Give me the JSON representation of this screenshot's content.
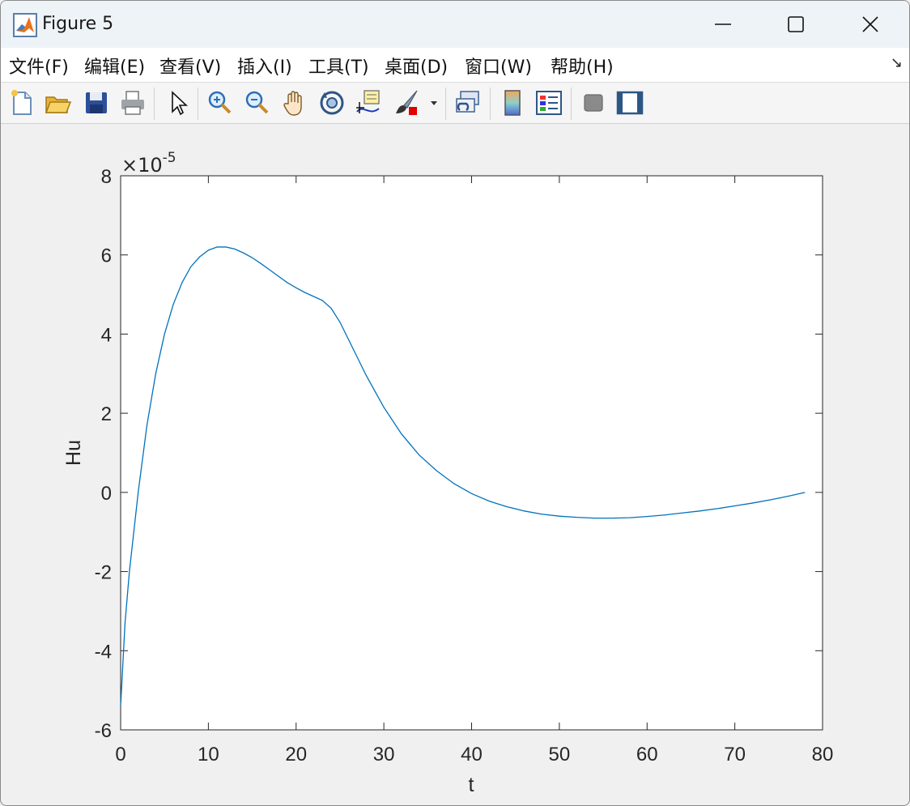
{
  "window": {
    "title": "Figure 5",
    "minimize_label": "—",
    "maximize_label": "☐",
    "close_label": "✕"
  },
  "menu": {
    "items": [
      {
        "label": "文件(F)",
        "name": "menu-file"
      },
      {
        "label": "编辑(E)",
        "name": "menu-edit"
      },
      {
        "label": "查看(V)",
        "name": "menu-view"
      },
      {
        "label": "插入(I)",
        "name": "menu-insert"
      },
      {
        "label": "工具(T)",
        "name": "menu-tools"
      },
      {
        "label": "桌面(D)",
        "name": "menu-desktop"
      },
      {
        "label": "窗口(W)",
        "name": "menu-window"
      },
      {
        "label": "帮助(H)",
        "name": "menu-help"
      }
    ],
    "dock_arrow": "↘"
  },
  "toolbar": {
    "icons": [
      "new-figure-icon",
      "open-folder-icon",
      "save-icon",
      "print-icon",
      "pointer-icon",
      "zoom-in-icon",
      "zoom-out-icon",
      "pan-hand-icon",
      "rotate-3d-icon",
      "data-cursor-icon",
      "brush-icon",
      "brush-dropdown-icon",
      "link-plot-icon",
      "colorbar-icon",
      "legend-icon",
      "hide-plot-tools-icon",
      "show-plot-tools-icon"
    ]
  },
  "chart_data": {
    "type": "line",
    "title": "",
    "xlabel": "t",
    "ylabel": "Hu",
    "exponent_label": "×10",
    "exponent_power": "-5",
    "xlim": [
      0,
      80
    ],
    "ylim": [
      -6,
      8
    ],
    "xticks": [
      0,
      10,
      20,
      30,
      40,
      50,
      60,
      70,
      80
    ],
    "yticks": [
      -6,
      -4,
      -2,
      0,
      2,
      4,
      6,
      8
    ],
    "line_color": "#0072bd",
    "grid": false,
    "series": [
      {
        "x": [
          0,
          0.5,
          1,
          2,
          3,
          4,
          5,
          6,
          7,
          8,
          9,
          10,
          11,
          12,
          13,
          14,
          15,
          16,
          17,
          18,
          19,
          20,
          21,
          22,
          23,
          24,
          25,
          26,
          27,
          28,
          29,
          30,
          32,
          34,
          36,
          38,
          40,
          42,
          44,
          46,
          48,
          50,
          52,
          54,
          56,
          58,
          60,
          62,
          64,
          66,
          68,
          70,
          72,
          74,
          76,
          78
        ],
        "y": [
          -5.4,
          -3.3,
          -2.0,
          0.0,
          1.7,
          3.0,
          4.0,
          4.75,
          5.3,
          5.7,
          5.95,
          6.12,
          6.2,
          6.2,
          6.15,
          6.05,
          5.93,
          5.78,
          5.62,
          5.46,
          5.3,
          5.17,
          5.05,
          4.95,
          4.85,
          4.65,
          4.3,
          3.85,
          3.4,
          2.95,
          2.55,
          2.15,
          1.48,
          0.95,
          0.55,
          0.22,
          -0.03,
          -0.22,
          -0.36,
          -0.47,
          -0.55,
          -0.6,
          -0.63,
          -0.65,
          -0.65,
          -0.64,
          -0.61,
          -0.57,
          -0.52,
          -0.47,
          -0.41,
          -0.34,
          -0.27,
          -0.19,
          -0.1,
          0.0
        ]
      }
    ]
  }
}
